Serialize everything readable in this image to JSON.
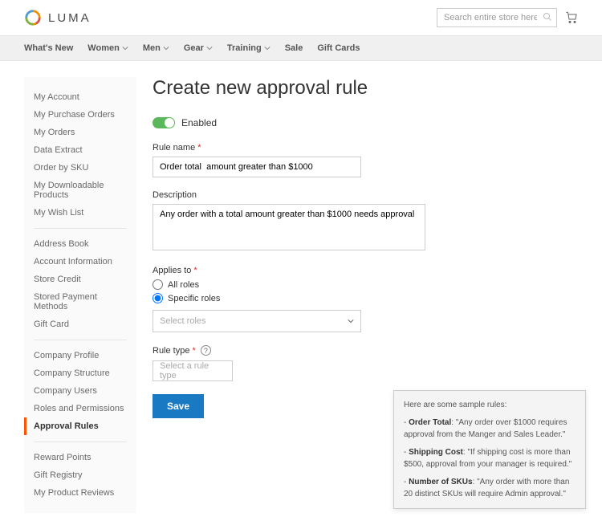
{
  "header": {
    "logo_text": "LUMA",
    "search_placeholder": "Search entire store here..."
  },
  "topnav": [
    {
      "label": "What's New",
      "dropdown": false
    },
    {
      "label": "Women",
      "dropdown": true
    },
    {
      "label": "Men",
      "dropdown": true
    },
    {
      "label": "Gear",
      "dropdown": true
    },
    {
      "label": "Training",
      "dropdown": true
    },
    {
      "label": "Sale",
      "dropdown": false
    },
    {
      "label": "Gift Cards",
      "dropdown": false
    }
  ],
  "sidebar": {
    "groups": [
      [
        "My Account",
        "My Purchase Orders",
        "My Orders",
        "Data Extract",
        "Order by SKU",
        "My Downloadable Products",
        "My Wish List"
      ],
      [
        "Address Book",
        "Account Information",
        "Store Credit",
        "Stored Payment Methods",
        "Gift Card"
      ],
      [
        "Company Profile",
        "Company Structure",
        "Company Users",
        "Roles and Permissions",
        "Approval Rules"
      ],
      [
        "Reward Points",
        "Gift Registry",
        "My Product Reviews"
      ]
    ],
    "active": "Approval Rules"
  },
  "form": {
    "title": "Create new approval rule",
    "enabled_label": "Enabled",
    "rulename_label": "Rule name",
    "rulename_value": "Order total  amount greater than $1000",
    "desc_label": "Description",
    "desc_value": "Any order with a total amount greater than $1000 needs approval",
    "applies_label": "Applies to",
    "applies_all": "All roles",
    "applies_specific": "Specific roles",
    "select_roles_placeholder": "Select roles",
    "ruletype_label": "Rule type",
    "ruletype_placeholder": "Select a rule type",
    "save_label": "Save"
  },
  "tooltip": {
    "intro": "Here are some sample rules:",
    "items": [
      {
        "t": "Order Total",
        "d": "\"Any order over $1000 requires approval from the Manger and Sales Leader.\""
      },
      {
        "t": "Shipping Cost",
        "d": "\"If shipping cost is more than $500, approval from your manager is required.\""
      },
      {
        "t": "Number of SKUs",
        "d": "\"Any order with more than 20 distinct SKUs will require Admin approval.\""
      }
    ]
  }
}
